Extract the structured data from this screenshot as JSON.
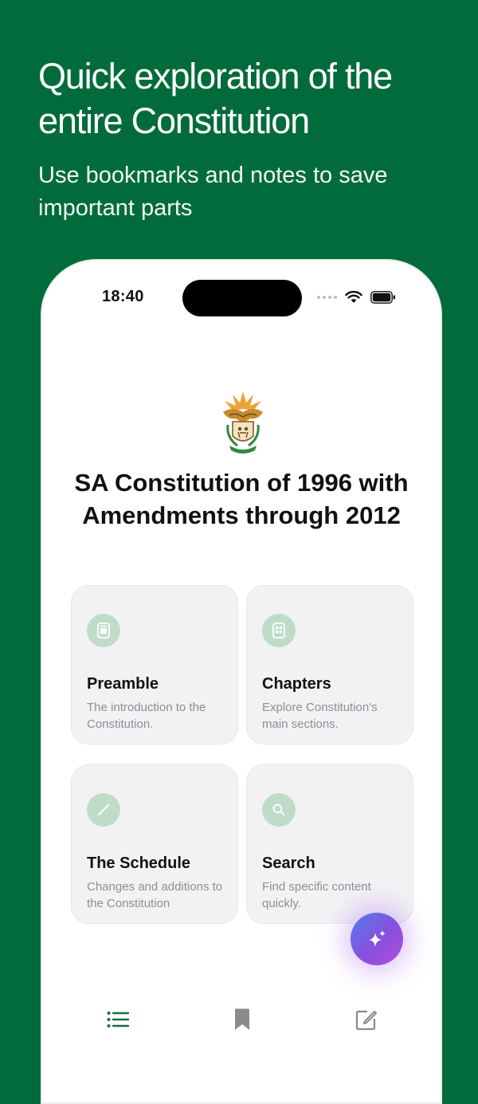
{
  "hero": {
    "title": "Quick exploration of the entire Constitution",
    "subtitle": "Use bookmarks and notes to save important parts"
  },
  "status_bar": {
    "time": "18:40",
    "icons": [
      "signal-dots-icon",
      "wifi-icon",
      "battery-icon"
    ]
  },
  "app": {
    "emblem_icon": "sa-coat-of-arms-icon",
    "title": "SA Constitution of 1996 with Amendments through 2012"
  },
  "cards": [
    {
      "title": "Preamble",
      "description": "The introduction to the Constitution.",
      "icon": "document-icon"
    },
    {
      "title": "Chapters",
      "description": "Explore Constitution's main sections.",
      "icon": "chapters-icon"
    },
    {
      "title": "The Schedule",
      "description": "Changes and additions to the Constitution",
      "icon": "pencil-icon"
    },
    {
      "title": "Search",
      "description": "Find specific content quickly.",
      "icon": "search-icon"
    }
  ],
  "fab": {
    "icon": "sparkles-icon"
  },
  "tab_bar": {
    "items": [
      {
        "name": "contents",
        "icon": "list-icon",
        "active": true
      },
      {
        "name": "bookmarks",
        "icon": "bookmark-icon",
        "active": false
      },
      {
        "name": "notes",
        "icon": "edit-note-icon",
        "active": false
      }
    ]
  },
  "colors": {
    "brand_green": "#026B3B",
    "card_bg": "#F2F2F4",
    "icon_circle": "#BFDCC9",
    "icon_glyph": "#FFFFFF",
    "tab_active": "#1E6B45",
    "tab_inactive": "#8A8A8E"
  }
}
